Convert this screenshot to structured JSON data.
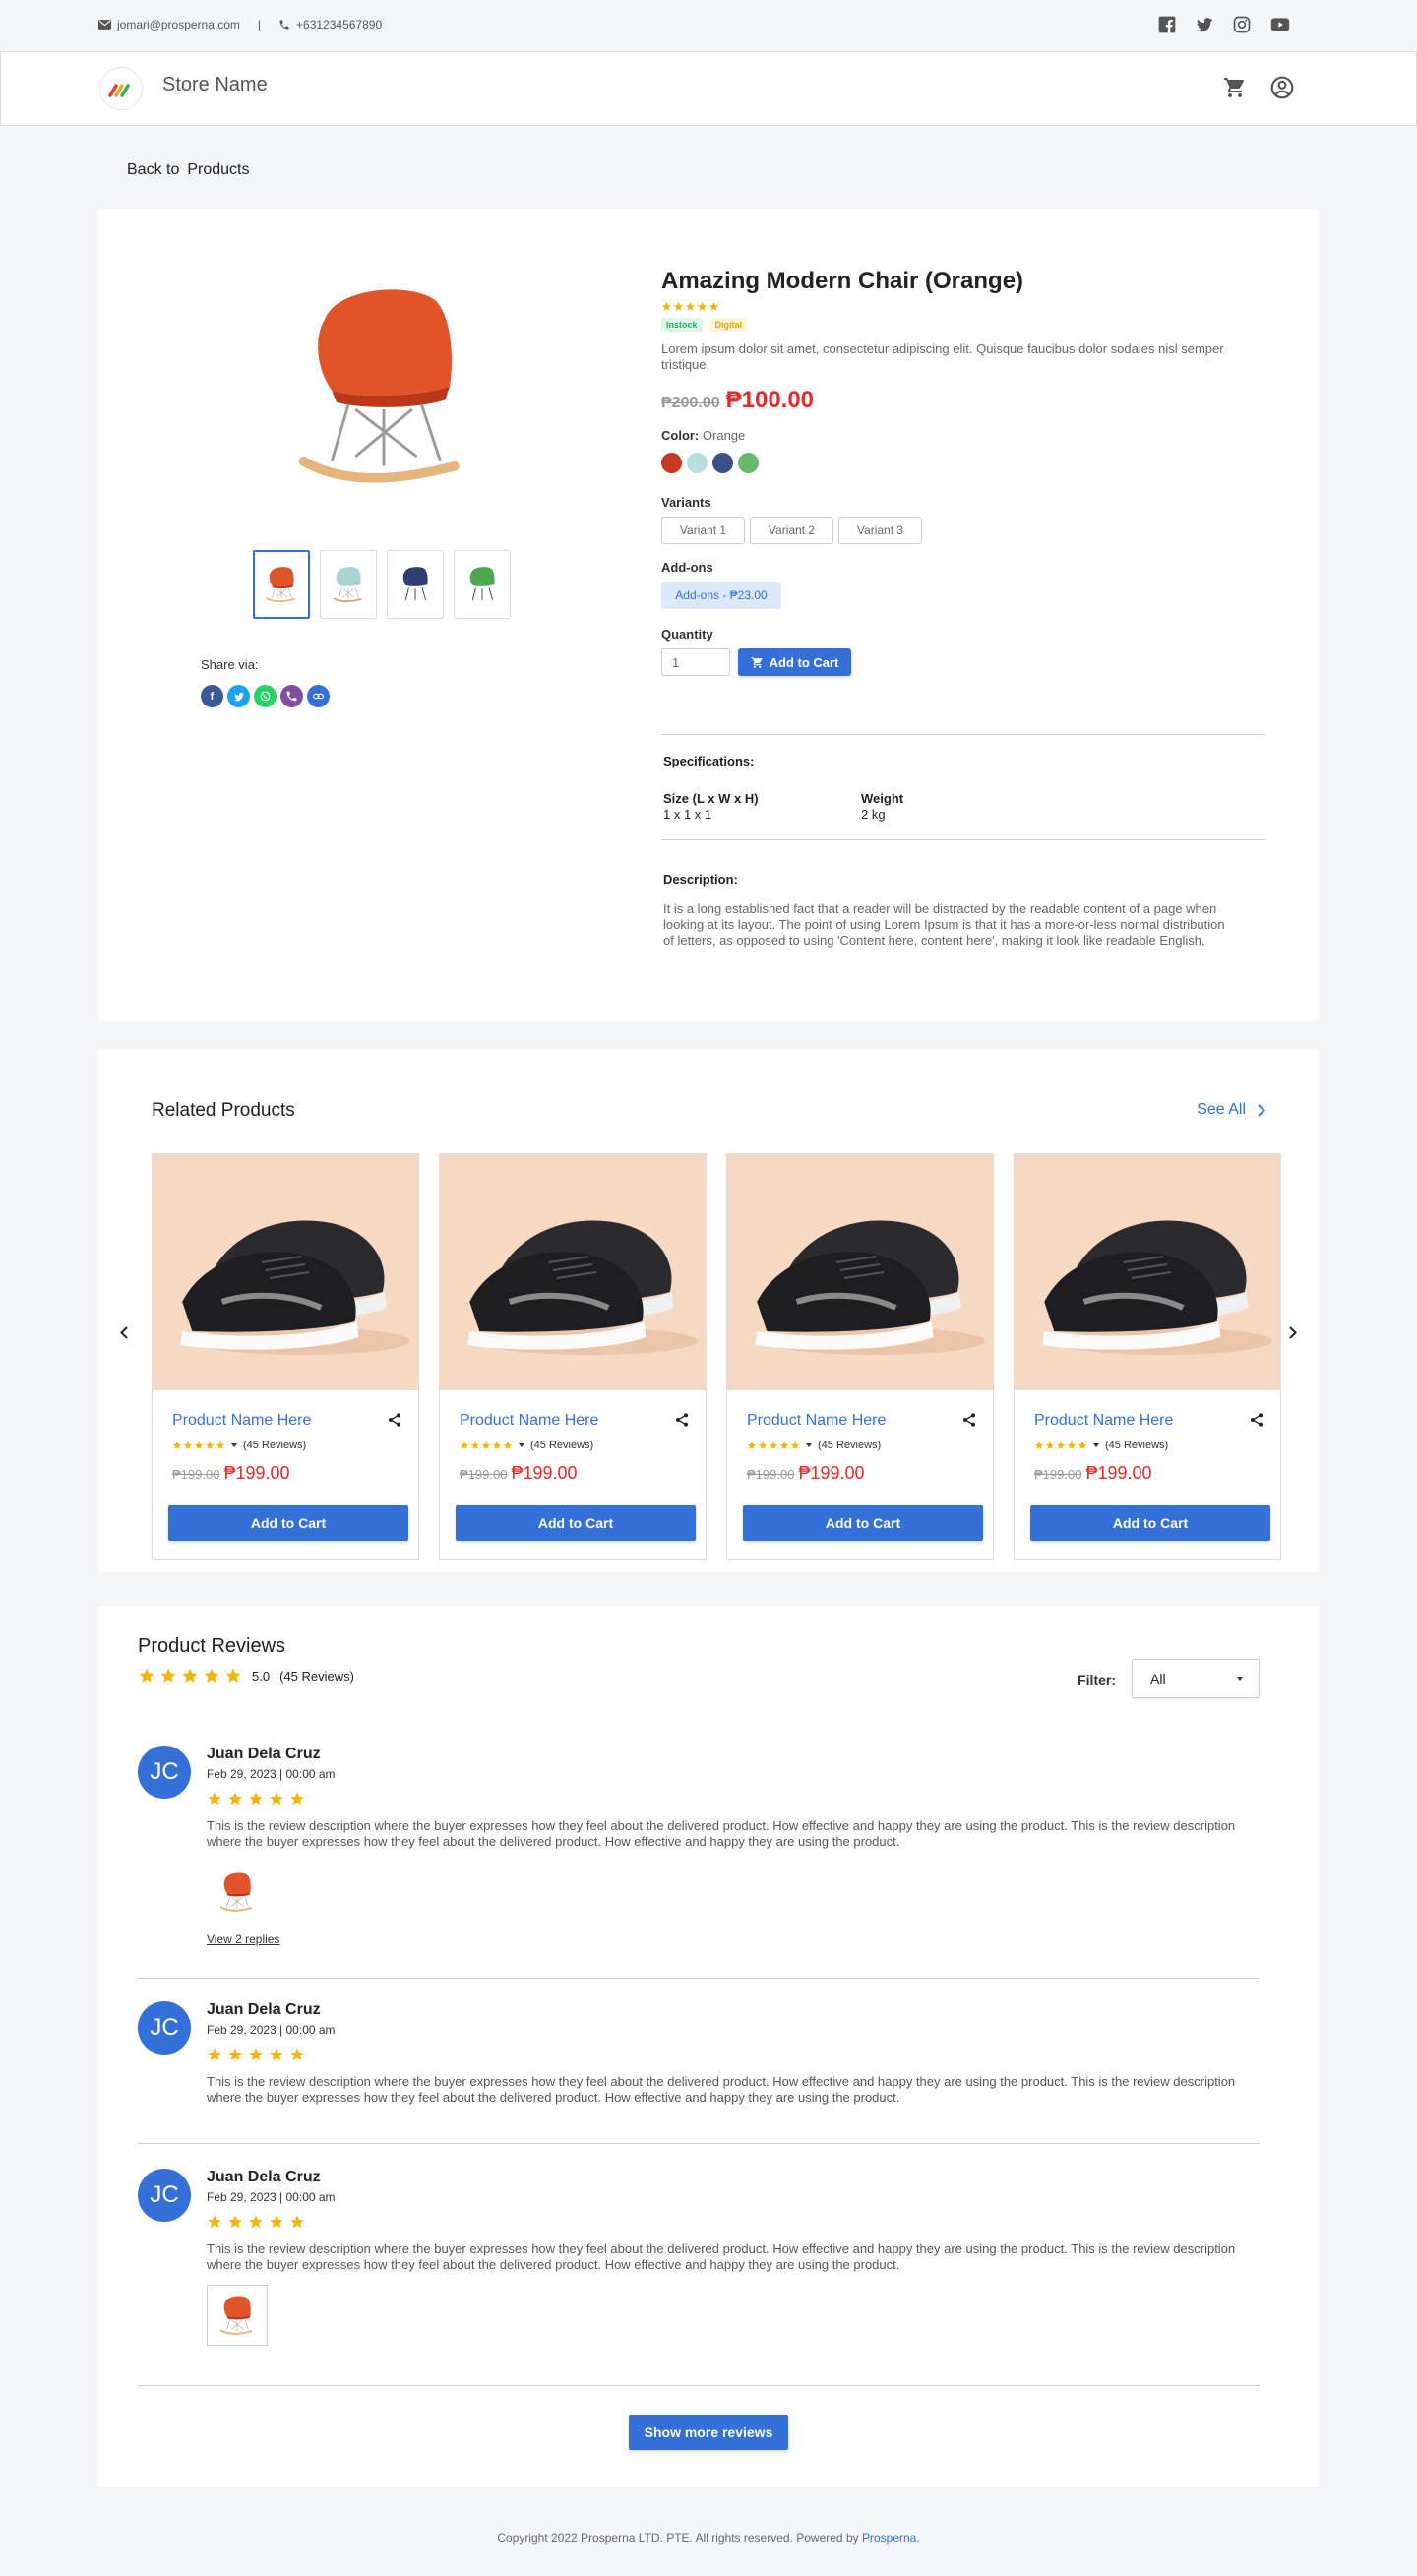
{
  "topbar": {
    "email": "jomari@prosperna.com",
    "separator": "|",
    "phone": "+631234567890",
    "social_icons": [
      "facebook-icon",
      "twitter-icon",
      "instagram-icon",
      "youtube-icon"
    ]
  },
  "header": {
    "store_name": "Store Name",
    "icons": [
      "cart-icon",
      "account-icon"
    ]
  },
  "breadcrumb": {
    "back_label": "Back to",
    "target": "Products"
  },
  "product": {
    "title": "Amazing Modern Chair (Orange)",
    "rating": 5,
    "badges": [
      "Instock",
      "Digital"
    ],
    "short_description": "Lorem ipsum dolor sit amet, consectetur adipiscing elit. Quisque faucibus dolor sodales nisl semper tristique.",
    "price_old": "₱200.00",
    "price_new": "₱100.00",
    "color_label": "Color:",
    "color_value": "Orange",
    "colors": [
      "#c6381c",
      "#b9dcdc",
      "#3c4f8a",
      "#6ab86c"
    ],
    "variants_label": "Variants",
    "variants": [
      "Variant 1",
      "Variant 2",
      "Variant 3"
    ],
    "addons_label": "Add-ons",
    "addon": "Add-ons - ₱23.00",
    "quantity_label": "Quantity",
    "quantity_value": "1",
    "add_to_cart": "Add to Cart",
    "share_label": "Share via:",
    "share_icons": [
      "facebook-share-icon",
      "twitter-share-icon",
      "whatsapp-share-icon",
      "viber-share-icon",
      "link-share-icon"
    ],
    "specifications_label": "Specifications:",
    "specs": [
      {
        "name": "Size (L x W x H)",
        "value": "1 x 1 x 1"
      },
      {
        "name": "Weight",
        "value": "2 kg"
      }
    ],
    "description_label": "Description:",
    "description": "It is a long established fact that a reader will be distracted by the readable content of a page when looking at its layout. The point of  using Lorem Ipsum is that it has a more-or-less normal distribution of letters, as opposed to using 'Content here, content here',  making it look like readable English."
  },
  "related": {
    "title": "Related Products",
    "see_all": "See All",
    "items": [
      {
        "name": "Product Name Here",
        "reviews": "(45 Reviews)",
        "price_old": "₱199.00",
        "price_new": "₱199.00",
        "button": "Add to Cart"
      },
      {
        "name": "Product Name Here",
        "reviews": "(45 Reviews)",
        "price_old": "₱199.00",
        "price_new": "₱199.00",
        "button": "Add to Cart"
      },
      {
        "name": "Product Name Here",
        "reviews": "(45 Reviews)",
        "price_old": "₱199.00",
        "price_new": "₱199.00",
        "button": "Add to Cart"
      },
      {
        "name": "Product Name Here",
        "reviews": "(45 Reviews)",
        "price_old": "₱199.00",
        "price_new": "₱199.00",
        "button": "Add to Cart"
      }
    ]
  },
  "reviews": {
    "title": "Product Reviews",
    "average": "5.0",
    "count": "(45 Reviews)",
    "filter_label": "Filter:",
    "filter_value": "All",
    "items": [
      {
        "initials": "JC",
        "name": "Juan Dela Cruz",
        "date": "Feb 29, 2023 | 00:00 am",
        "stars": 5,
        "text": "This is the review description where the buyer expresses how they feel about the delivered product. How effective and happy they are using the product. This is the review description where the buyer expresses how they feel about the delivered product. How effective and happy they are using the product.",
        "replies": "View 2 replies"
      },
      {
        "initials": "JC",
        "name": "Juan Dela Cruz",
        "date": "Feb 29, 2023 | 00:00 am",
        "stars": 5,
        "text": "This is the review description where the buyer expresses how they feel about the delivered product. How effective and happy they are using the product. This is the review description where the buyer expresses how they feel about the delivered product. How effective and happy they are using the product."
      },
      {
        "initials": "JC",
        "name": "Juan Dela Cruz",
        "date": "Feb 29, 2023 | 00:00 am",
        "stars": 5,
        "text": "This is the review description where the buyer expresses how they feel about the delivered product. How effective and happy they are using the product. This is the review description where the buyer expresses how they feel about the delivered product. How effective and happy they are using the product."
      }
    ],
    "show_more": "Show more reviews"
  },
  "footer": {
    "text": "Copyright  2022 Prosperna LTD. PTE. All rights reserved. Powered by",
    "link": "Prosperna."
  },
  "colors": {
    "primary": "#3570d8",
    "sale_price": "#e42a2a",
    "star": "#f5b400"
  }
}
